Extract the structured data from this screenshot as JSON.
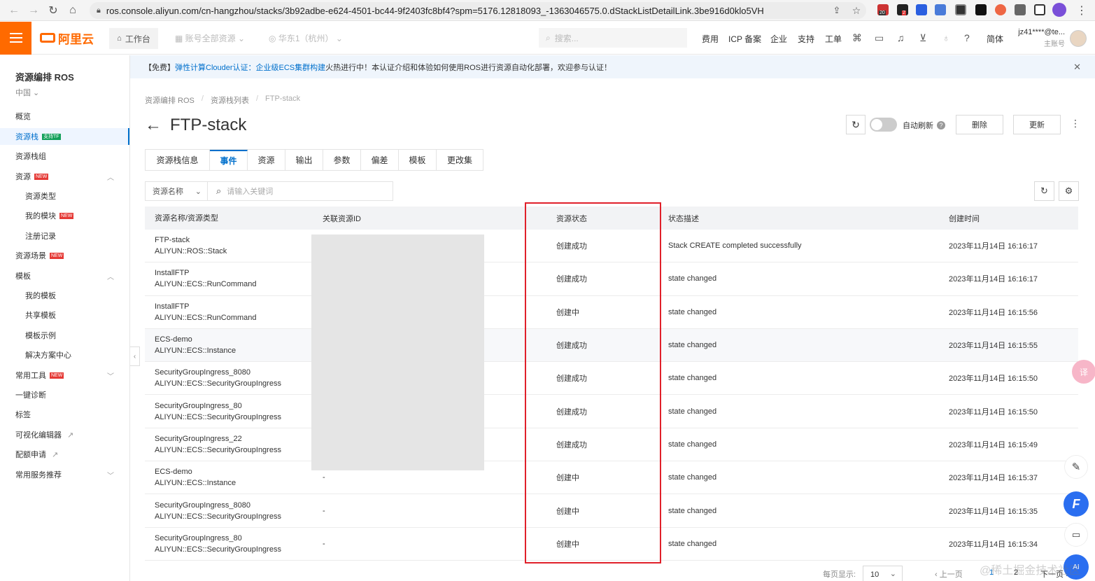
{
  "browser": {
    "url_scheme": "ros.console.aliyun.com",
    "url_path": "/cn-hangzhou/stacks/3b92adbe-e624-4501-bc44-9f2403fc8bf4?spm=5176.12818093_-1363046575.0.dStackListDetailLink.3be916d0klo5VH",
    "ext_badge_1": "20",
    "ext_badge_2": "2"
  },
  "topbar": {
    "logo_text": "阿里云",
    "workbench": "工作台",
    "resource_scope": "账号全部资源",
    "region": "华东1（杭州）",
    "search_placeholder": "搜索...",
    "nav": [
      "费用",
      "ICP 备案",
      "企业",
      "支持",
      "工单"
    ],
    "lang": "简体",
    "account_name": "jz41****@te...",
    "account_type": "主账号"
  },
  "sidebar": {
    "title": "资源编排 ROS",
    "region": "中国",
    "items": [
      {
        "label": "概览"
      },
      {
        "label": "资源栈",
        "badge": "支持TF"
      },
      {
        "label": "资源栈组"
      },
      {
        "label": "资源",
        "badge": "NEW"
      },
      {
        "label": "资源类型"
      },
      {
        "label": "我的模块",
        "badge": "NEW"
      },
      {
        "label": "注册记录"
      },
      {
        "label": "资源场景",
        "badge": "NEW"
      },
      {
        "label": "模板"
      },
      {
        "label": "我的模板"
      },
      {
        "label": "共享模板"
      },
      {
        "label": "模板示例"
      },
      {
        "label": "解决方案中心"
      },
      {
        "label": "常用工具",
        "badge": "NEW"
      },
      {
        "label": "一键诊断"
      },
      {
        "label": "标签"
      },
      {
        "label": "可视化编辑器"
      },
      {
        "label": "配额申请"
      },
      {
        "label": "常用服务推荐"
      }
    ]
  },
  "notice": {
    "prefix": "【免费】",
    "link": "弹性计算Clouder认证：企业级ECS集群构建",
    "text": "火热进行中！本认证介绍和体验如何使用ROS进行资源自动化部署，欢迎参与认证！"
  },
  "breadcrumb": [
    "资源编排 ROS",
    "资源栈列表",
    "FTP-stack"
  ],
  "page": {
    "title": "FTP-stack",
    "auto_refresh_label": "自动刷新",
    "delete_label": "删除",
    "update_label": "更新"
  },
  "tabs": [
    "资源栈信息",
    "事件",
    "资源",
    "输出",
    "参数",
    "偏差",
    "模板",
    "更改集"
  ],
  "filter": {
    "select_value": "资源名称",
    "placeholder": "请输入关键词"
  },
  "table": {
    "headers": [
      "资源名称/资源类型",
      "关联资源ID",
      "资源状态",
      "状态描述",
      "创建时间"
    ],
    "rows": [
      {
        "name": "FTP-stack",
        "type": "ALIYUN::ROS::Stack",
        "id": "",
        "status": "创建成功",
        "desc": "Stack CREATE completed successfully",
        "time": "2023年11月14日 16:16:17"
      },
      {
        "name": "InstallFTP",
        "type": "ALIYUN::ECS::RunCommand",
        "id": "",
        "status": "创建成功",
        "desc": "state changed",
        "time": "2023年11月14日 16:16:17"
      },
      {
        "name": "InstallFTP",
        "type": "ALIYUN::ECS::RunCommand",
        "id": "",
        "status": "创建中",
        "desc": "state changed",
        "time": "2023年11月14日 16:15:56"
      },
      {
        "name": "ECS-demo",
        "type": "ALIYUN::ECS::Instance",
        "id": "",
        "status": "创建成功",
        "desc": "state changed",
        "time": "2023年11月14日 16:15:55"
      },
      {
        "name": "SecurityGroupIngress_8080",
        "type": "ALIYUN::ECS::SecurityGroupIngress",
        "id": "",
        "status": "创建成功",
        "desc": "state changed",
        "time": "2023年11月14日 16:15:50"
      },
      {
        "name": "SecurityGroupIngress_80",
        "type": "ALIYUN::ECS::SecurityGroupIngress",
        "id": "",
        "status": "创建成功",
        "desc": "state changed",
        "time": "2023年11月14日 16:15:50"
      },
      {
        "name": "SecurityGroupIngress_22",
        "type": "ALIYUN::ECS::SecurityGroupIngress",
        "id": "",
        "status": "创建成功",
        "desc": "state changed",
        "time": "2023年11月14日 16:15:49"
      },
      {
        "name": "ECS-demo",
        "type": "ALIYUN::ECS::Instance",
        "id": "-",
        "status": "创建中",
        "desc": "state changed",
        "time": "2023年11月14日 16:15:37"
      },
      {
        "name": "SecurityGroupIngress_8080",
        "type": "ALIYUN::ECS::SecurityGroupIngress",
        "id": "-",
        "status": "创建中",
        "desc": "state changed",
        "time": "2023年11月14日 16:15:35"
      },
      {
        "name": "SecurityGroupIngress_80",
        "type": "ALIYUN::ECS::SecurityGroupIngress",
        "id": "-",
        "status": "创建中",
        "desc": "state changed",
        "time": "2023年11月14日 16:15:34"
      }
    ]
  },
  "pager": {
    "page_size_label": "每页显示:",
    "page_size": "10",
    "prev": "上一页",
    "pages": [
      "1",
      "2"
    ],
    "next": "下一页"
  },
  "watermark": "@稀土掘金技术社区",
  "colors": {
    "brand": "#ff6a00",
    "link": "#0070cc",
    "highlight": "#e0202a"
  }
}
